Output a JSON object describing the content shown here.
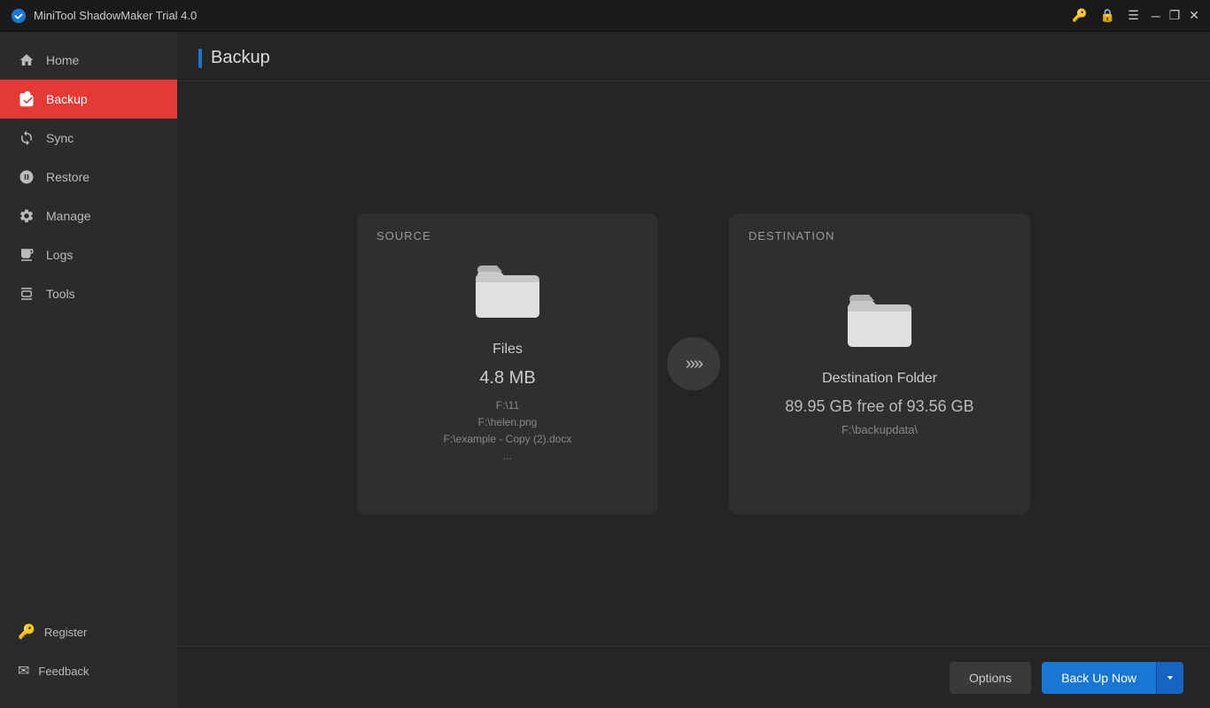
{
  "titleBar": {
    "appName": "MiniTool ShadowMaker Trial 4.0",
    "icons": {
      "key": "🔑",
      "lock": "🔒",
      "menu": "☰",
      "minimize": "─",
      "maximize": "❐",
      "close": "✕"
    }
  },
  "sidebar": {
    "items": [
      {
        "id": "home",
        "label": "Home",
        "active": false
      },
      {
        "id": "backup",
        "label": "Backup",
        "active": true
      },
      {
        "id": "sync",
        "label": "Sync",
        "active": false
      },
      {
        "id": "restore",
        "label": "Restore",
        "active": false
      },
      {
        "id": "manage",
        "label": "Manage",
        "active": false
      },
      {
        "id": "logs",
        "label": "Logs",
        "active": false
      },
      {
        "id": "tools",
        "label": "Tools",
        "active": false
      }
    ],
    "bottomItems": [
      {
        "id": "register",
        "label": "Register"
      },
      {
        "id": "feedback",
        "label": "Feedback"
      }
    ]
  },
  "page": {
    "title": "Backup"
  },
  "source": {
    "label": "SOURCE",
    "icon": "folder",
    "name": "Files",
    "size": "4.8 MB",
    "paths": [
      "F:\\11",
      "F:\\helen.png",
      "F:\\example - Copy (2).docx",
      "..."
    ]
  },
  "destination": {
    "label": "DESTINATION",
    "icon": "folder",
    "folderName": "Destination Folder",
    "free": "89.95 GB free of 93.56 GB",
    "path": "F:\\backupdata\\"
  },
  "footer": {
    "optionsLabel": "Options",
    "backupNowLabel": "Back Up Now"
  }
}
